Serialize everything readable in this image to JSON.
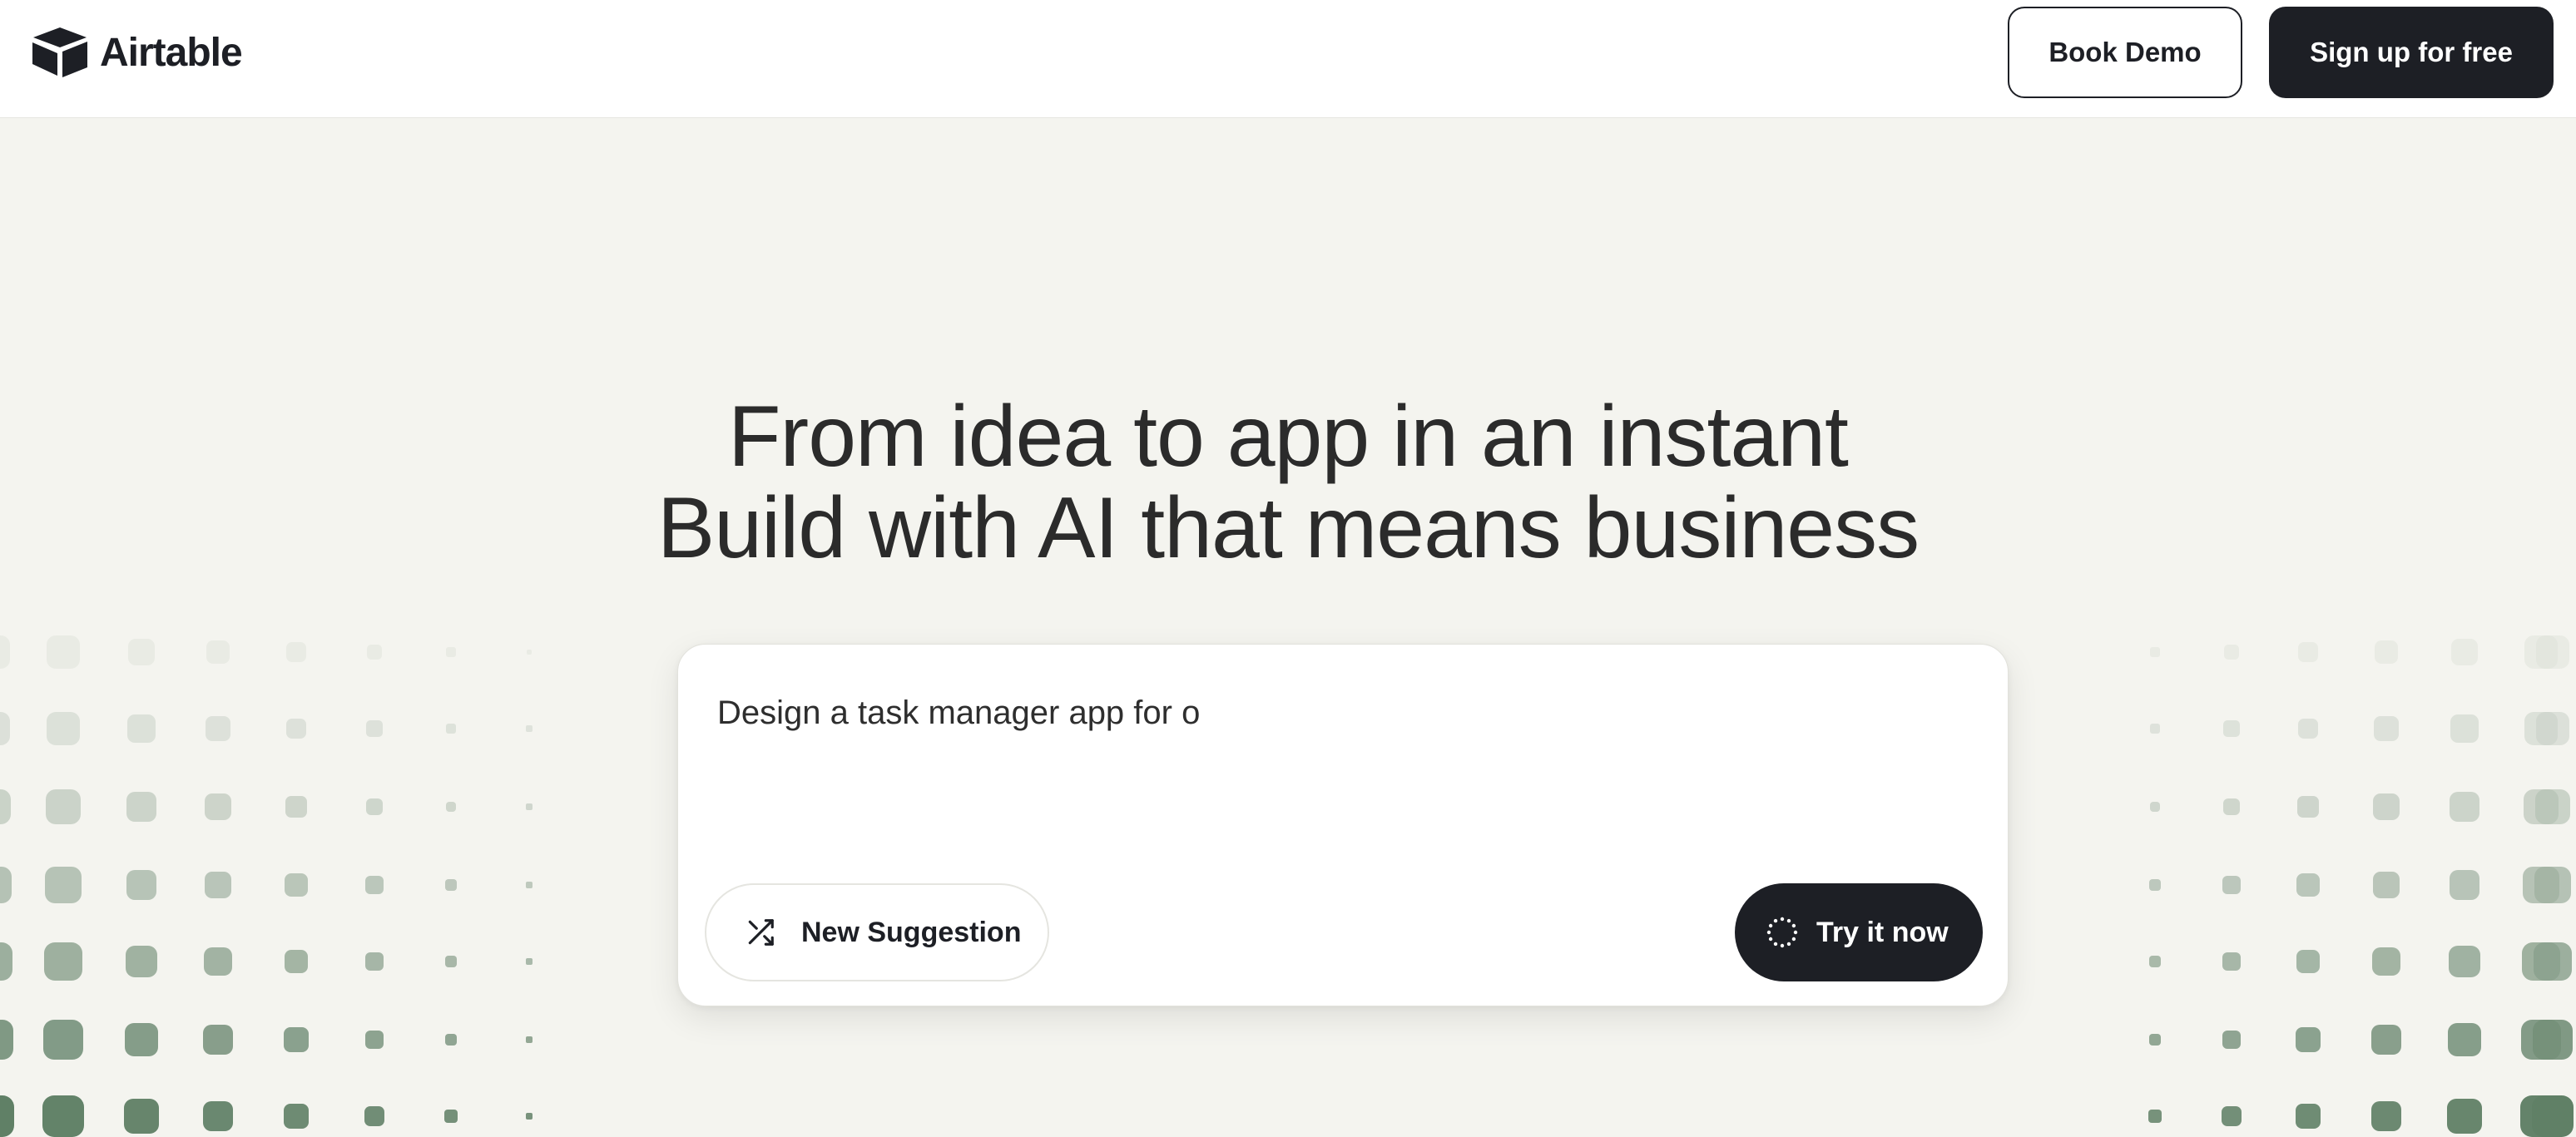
{
  "header": {
    "brand": "Airtable",
    "book_demo_label": "Book Demo",
    "signup_label": "Sign up for free"
  },
  "hero": {
    "line1": "From idea to app in an instant",
    "line2": "Build with AI that means business"
  },
  "prompt": {
    "text": "Design a task manager app for o",
    "suggestion_label": "New Suggestion",
    "try_label": "Try it now"
  },
  "icons": {
    "logo": "airtable-logo",
    "shuffle": "shuffle-icon",
    "spinner": "spinner-icon"
  },
  "colors": {
    "background": "#f4f4ef",
    "dark": "#1d1f25",
    "dot_green": "#6b8a70"
  }
}
